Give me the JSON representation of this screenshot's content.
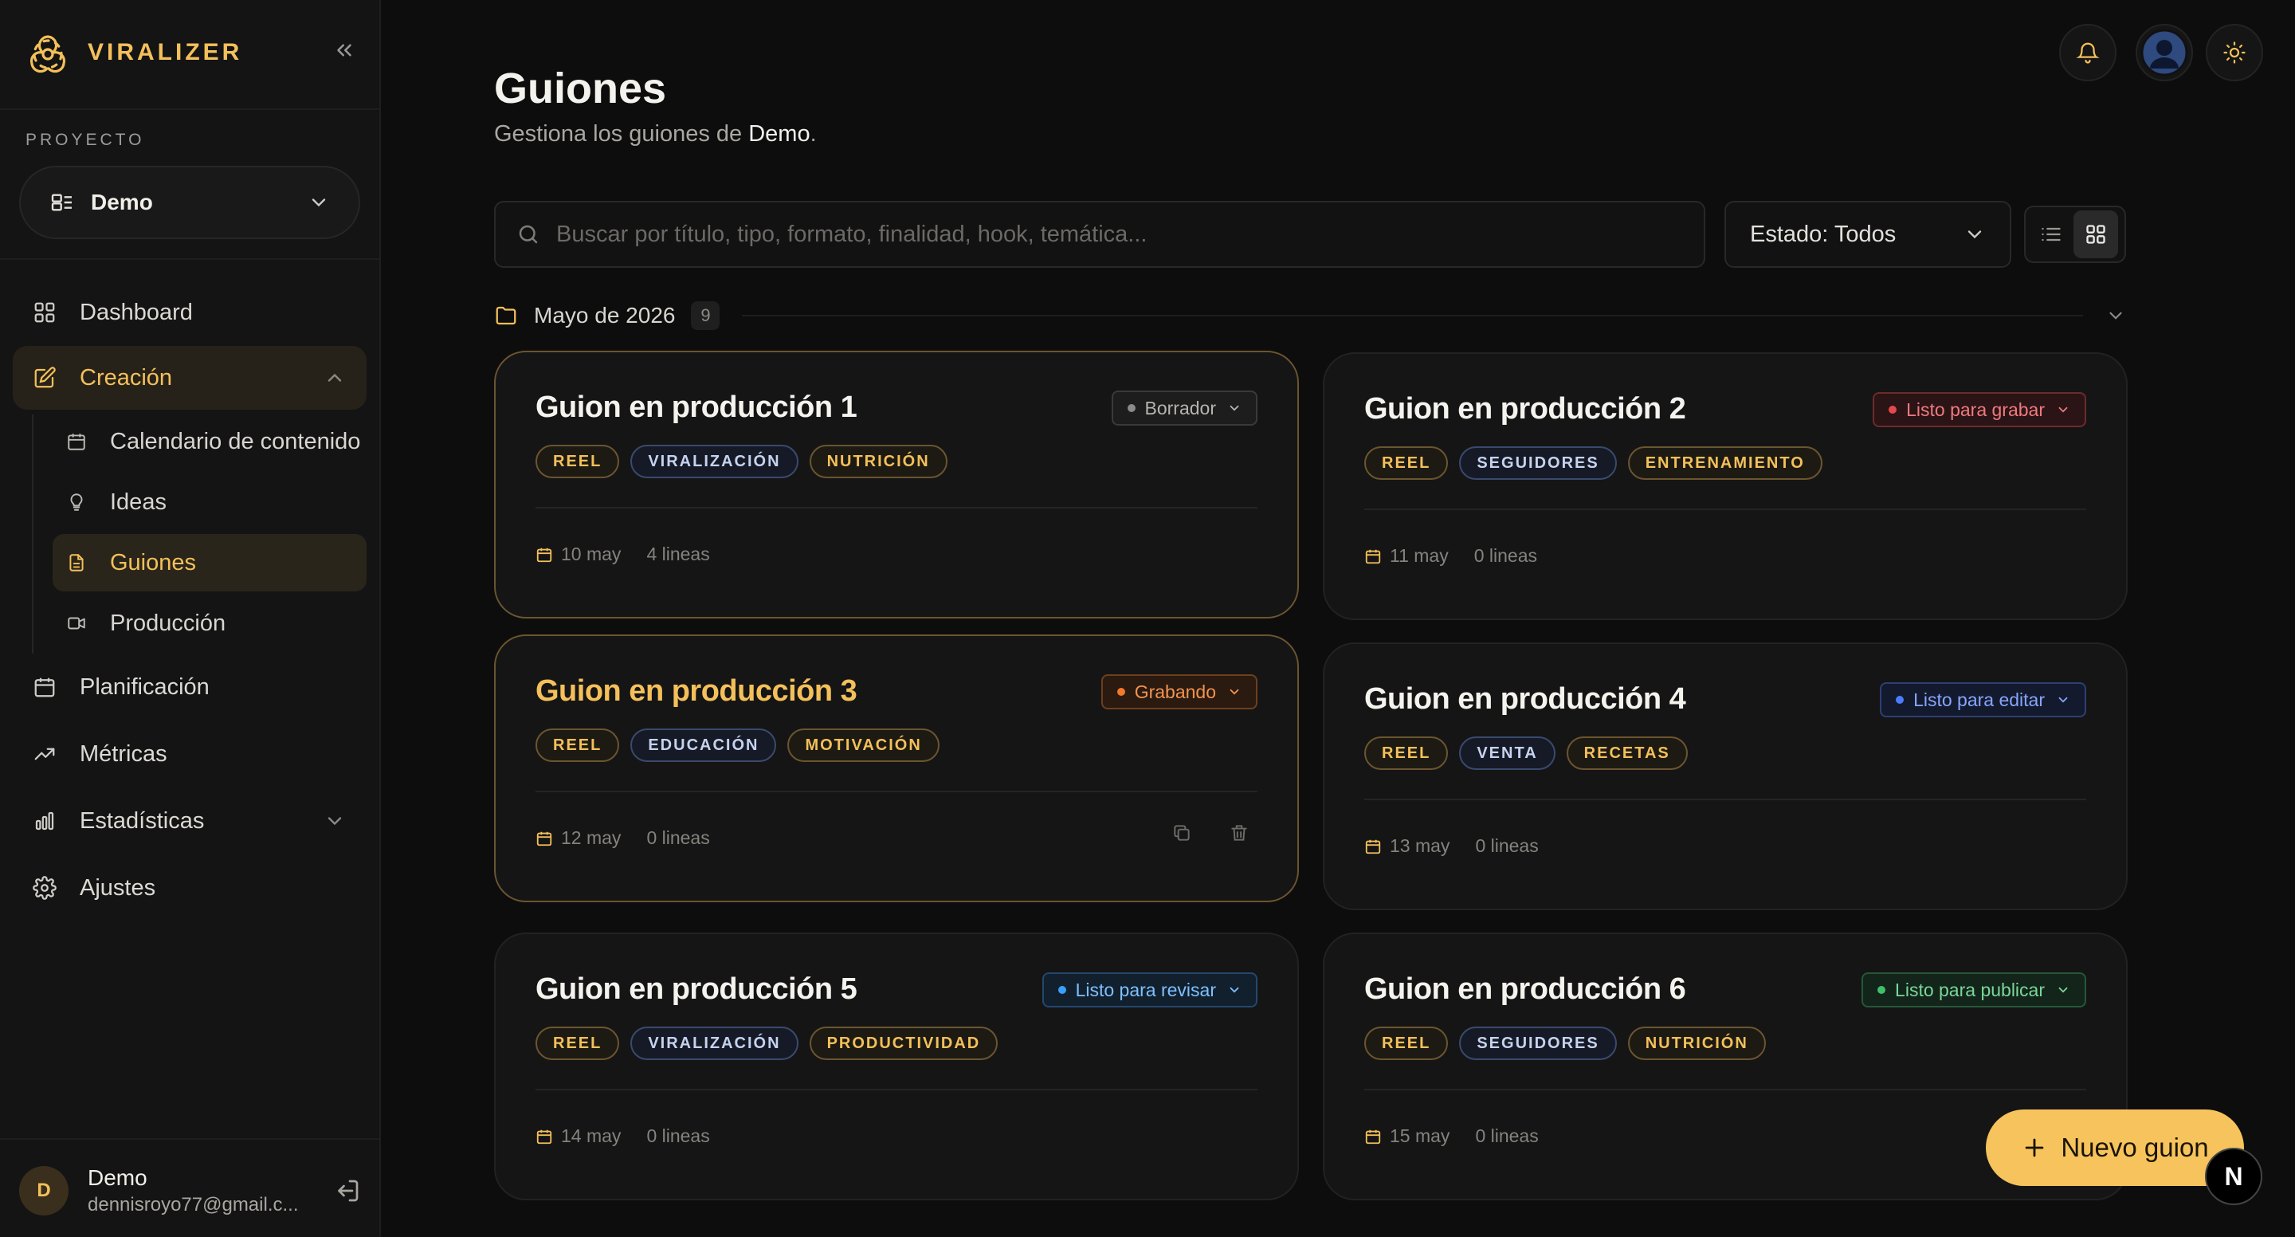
{
  "brand": {
    "name": "VIRALIZER"
  },
  "sidebar": {
    "project_label": "PROYECTO",
    "project_name": "Demo",
    "nav": {
      "dashboard": "Dashboard",
      "creacion": "Creación",
      "calendario": "Calendario de contenido",
      "ideas": "Ideas",
      "guiones": "Guiones",
      "produccion": "Producción",
      "planificacion": "Planificación",
      "metricas": "Métricas",
      "estadisticas": "Estadísticas",
      "ajustes": "Ajustes"
    },
    "user": {
      "initial": "D",
      "name": "Demo",
      "email": "dennisroyo77@gmail.c..."
    }
  },
  "main": {
    "title": "Guiones",
    "subtitle_prefix": "Gestiona los guiones de ",
    "subtitle_project": "Demo",
    "subtitle_suffix": ".",
    "search_placeholder": "Buscar por título, tipo, formato, finalidad, hook, temática...",
    "status_filter": "Estado: Todos",
    "group": {
      "title": "Mayo de 2026",
      "count": "9"
    }
  },
  "cards": [
    {
      "title": "Guion en producción 1",
      "status": "Borrador",
      "tags": [
        "REEL",
        "VIRALIZACIÓN",
        "NUTRICIÓN"
      ],
      "date": "10 may",
      "lines": "4 lineas"
    },
    {
      "title": "Guion en producción 2",
      "status": "Listo para grabar",
      "tags": [
        "REEL",
        "SEGUIDORES",
        "ENTRENAMIENTO"
      ],
      "date": "11 may",
      "lines": "0 lineas"
    },
    {
      "title": "Guion en producción 3",
      "status": "Grabando",
      "tags": [
        "REEL",
        "EDUCACIÓN",
        "MOTIVACIÓN"
      ],
      "date": "12 may",
      "lines": "0 lineas"
    },
    {
      "title": "Guion en producción 4",
      "status": "Listo para editar",
      "tags": [
        "REEL",
        "VENTA",
        "RECETAS"
      ],
      "date": "13 may",
      "lines": "0 lineas"
    },
    {
      "title": "Guion en producción 5",
      "status": "Listo para revisar",
      "tags": [
        "REEL",
        "VIRALIZACIÓN",
        "PRODUCTIVIDAD"
      ],
      "date": "14 may",
      "lines": "0 lineas"
    },
    {
      "title": "Guion en producción 6",
      "status": "Listo para publicar",
      "tags": [
        "REEL",
        "SEGUIDORES",
        "NUTRICIÓN"
      ],
      "date": "15 may",
      "lines": "0 lineas"
    }
  ],
  "fab": {
    "label": "Nuevo guion"
  },
  "next_badge": "N",
  "colors": {
    "accent": "#f4c05a",
    "status_borrador": "#8a8a8a",
    "status_listo_grabar": "#e5484d",
    "status_grabando": "#f07a2a",
    "status_listo_editar": "#4a7dff",
    "status_listo_revisar": "#3aa0ff",
    "status_listo_publicar": "#3fbf6a"
  }
}
